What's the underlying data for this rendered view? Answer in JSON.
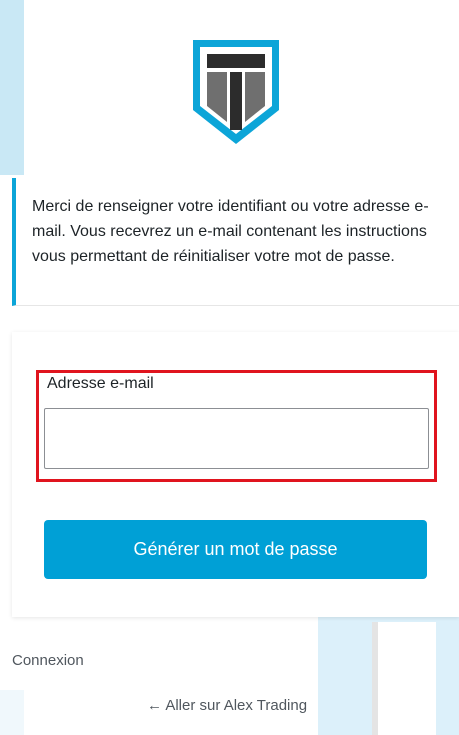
{
  "logo": {
    "icon": "shield-t-logo",
    "colors": {
      "primary": "#0ca5d8",
      "inner": "#2c2c2c",
      "accent": "#7a7a7a"
    }
  },
  "message": {
    "text": "Merci de renseigner votre identifiant ou votre adresse e-mail. Vous recevrez un e-mail contenant les instructions vous permettant de réinitialiser votre mot de passe."
  },
  "form": {
    "email_label": "Adresse e-mail",
    "email_value": "",
    "email_placeholder": "",
    "submit_label": "Générer un mot de passe"
  },
  "nav": {
    "login_link": "Connexion",
    "back_link": "← Aller sur Alex Trading"
  },
  "colors": {
    "accent": "#00a0d6",
    "highlight": "#e0141e"
  }
}
